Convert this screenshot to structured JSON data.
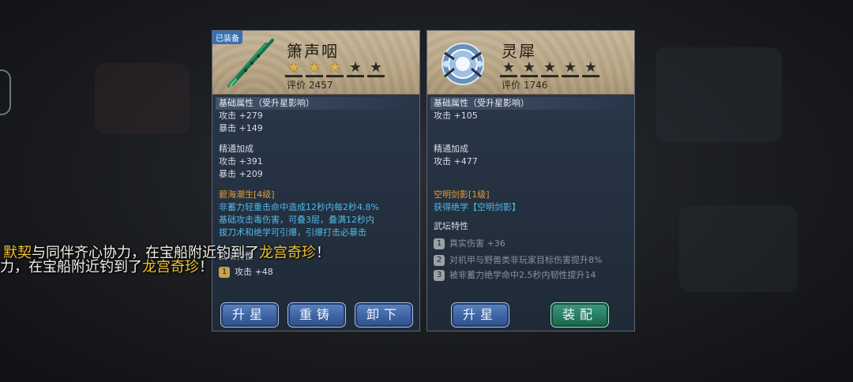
{
  "left_item": {
    "badge": "已装备",
    "name": "箫声咽",
    "stars_lit": 3,
    "stars_total": 5,
    "rating": "评价  2457",
    "base_title": "基础属性（受升星影响）",
    "base_lines": [
      "攻击 +279",
      "暴击 +149"
    ],
    "mastery_title": "精通加成",
    "mastery_lines": [
      "攻击 +391",
      "暴击 +209"
    ],
    "skill_title": "碧海潮生[4级]",
    "skill_lines": [
      "非蓄力轻重击命中造成12秒内每2秒4.8%",
      "基础攻击毒伤害，可叠3层，叠满12秒内",
      "拔刀术和绝学可引爆，引爆打击必暴击"
    ],
    "trait_title": "武坛特性",
    "trait_num": "1",
    "trait_text": "攻击 +48",
    "buttons": [
      "升星",
      "重铸",
      "卸下"
    ]
  },
  "right_item": {
    "name": "灵犀",
    "stars_lit": 0,
    "stars_total": 5,
    "rating": "评价  1746",
    "base_title": "基础属性（受升星影响）",
    "base_lines": [
      "攻击 +105"
    ],
    "mastery_title": "精通加成",
    "mastery_lines": [
      "攻击 +477"
    ],
    "skill_title": "空明剑影[1级]",
    "skill_line": "获得绝学【空明剑影】",
    "trait_title": "武坛特性",
    "traits": [
      {
        "num": "1",
        "text": "真实伤害 +36"
      },
      {
        "num": "2",
        "text": "对机甲与野兽类非玩家目标伤害提升8%"
      },
      {
        "num": "3",
        "text": "被非蓄力绝学命中2.5秒内韧性提升14"
      }
    ],
    "buttons": [
      "升星",
      "装配"
    ]
  },
  "chat": {
    "line1_a": "默契",
    "line1_b": "与同伴齐心协力，在宝船附近钓到了",
    "line1_c": "龙宫奇珍",
    "line1_d": "！",
    "line2_a": "力，在宝船附近钓到了",
    "line2_b": "龙宫奇珍",
    "line2_c": "！"
  },
  "colors": {
    "accent_orange": "#e39b3a",
    "accent_cyan": "#4fb9e6",
    "star_lit": "#e0b24a",
    "button_blue": "#3e64a3",
    "button_green": "#267b61"
  }
}
